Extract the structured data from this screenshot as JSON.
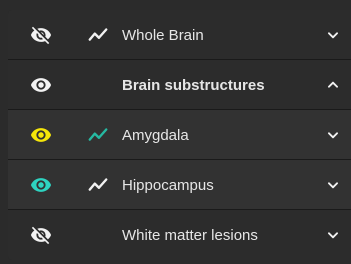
{
  "panel": {
    "rows": [
      {
        "label": "Whole Brain",
        "visibility_icon": "eye-off-icon",
        "visibility_color": "#f2f2f2",
        "has_graph_icon": true,
        "graph_color": "#f2f2f2",
        "expanded": false
      },
      {
        "label": "Brain substructures",
        "visibility_icon": "eye-icon",
        "visibility_color": "#f2f2f2",
        "has_graph_icon": false,
        "expanded": true
      },
      {
        "label": "Amygdala",
        "visibility_icon": "eye-icon",
        "visibility_color": "#f5e60a",
        "has_graph_icon": true,
        "graph_color": "#26b9a2",
        "expanded": false
      },
      {
        "label": "Hippocampus",
        "visibility_icon": "eye-icon",
        "visibility_color": "#2ed3c0",
        "has_graph_icon": true,
        "graph_color": "#f2f2f2",
        "expanded": false
      },
      {
        "label": "White matter lesions",
        "visibility_icon": "eye-off-icon",
        "visibility_color": "#f2f2f2",
        "has_graph_icon": false,
        "expanded": false
      }
    ]
  }
}
